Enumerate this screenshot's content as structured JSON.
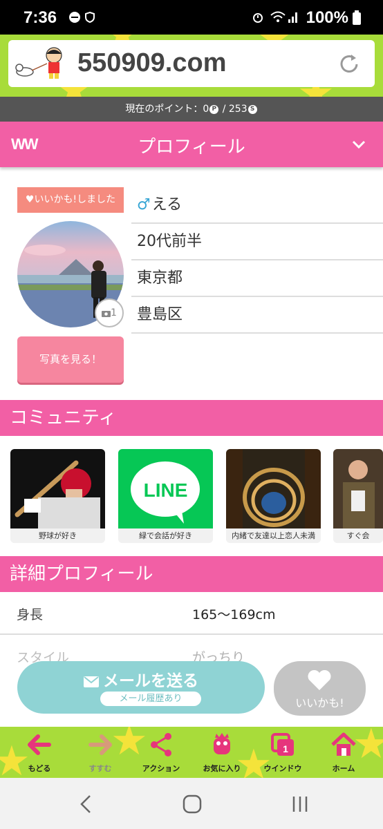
{
  "status_bar": {
    "time": "7:36",
    "battery": "100%"
  },
  "site": {
    "url": "550909.com"
  },
  "points": {
    "text_prefix": "現在のポイント：0",
    "separator": "/ 253",
    "p_badge": "P",
    "s_badge": "S"
  },
  "profile_header": {
    "logo": "WW",
    "title": "プロフィール"
  },
  "profile": {
    "like_badge": "♥いいかも!しました",
    "photo_count": "1",
    "view_photo": "写真を見る！",
    "gender_symbol": "♂",
    "name": "える",
    "age": "20代前半",
    "prefecture": "東京都",
    "city": "豊島区"
  },
  "community": {
    "title": "コミュニティ",
    "items": [
      {
        "label": "野球が好き"
      },
      {
        "label": "緑で会話が好き",
        "logo_text": "LINE"
      },
      {
        "label": "内緒で友達以上恋人未満"
      },
      {
        "label": "すぐ会"
      }
    ]
  },
  "details": {
    "title": "詳細プロフィール",
    "rows": [
      {
        "label": "身長",
        "value": "165〜169cm"
      },
      {
        "label": "スタイル",
        "value": "がっちり"
      }
    ]
  },
  "actions": {
    "mail": "メールを送る",
    "mail_history": "メール履歴あり",
    "like": "いいかも!"
  },
  "nav": [
    "もどる",
    "すすむ",
    "アクション",
    "お気に入り",
    "ウインドウ",
    "ホーム"
  ],
  "colors": {
    "pink": "#f25fa5",
    "green": "#a8dc3a",
    "teal": "#8fd3d4"
  }
}
